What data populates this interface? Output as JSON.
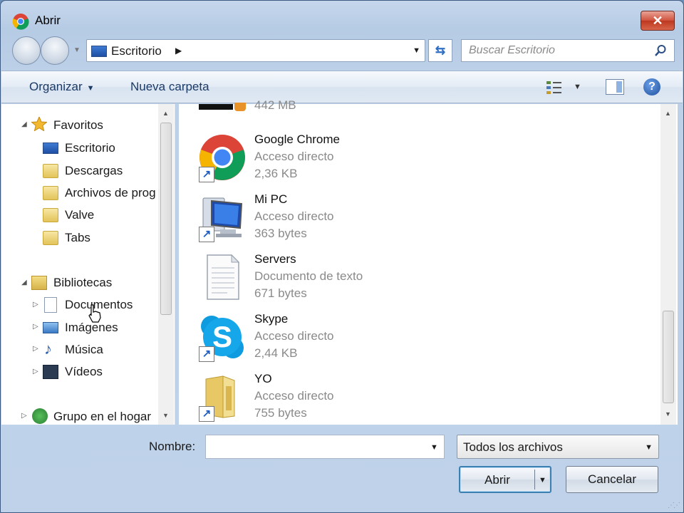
{
  "window": {
    "title": "Abrir",
    "close_label": "✕"
  },
  "address_bar": {
    "location": "Escritorio",
    "search_placeholder": "Buscar Escritorio"
  },
  "toolbar": {
    "organize_label": "Organizar",
    "new_folder_label": "Nueva carpeta"
  },
  "nav_tree": {
    "favorites": {
      "label": "Favoritos",
      "items": [
        "Escritorio",
        "Descargas",
        "Archivos de prog",
        "Valve",
        "Tabs"
      ]
    },
    "libraries": {
      "label": "Bibliotecas",
      "items": [
        "Documentos",
        "Imágenes",
        "Música",
        "Vídeos"
      ]
    },
    "homegroup": "Grupo en el hogar"
  },
  "files": [
    {
      "size": "442 MB"
    },
    {
      "name": "Google Chrome",
      "type": "Acceso directo",
      "size": "2,36 KB",
      "icon": "chrome-icon"
    },
    {
      "name": "Mi PC",
      "type": "Acceso directo",
      "size": "363 bytes",
      "icon": "computer-icon"
    },
    {
      "name": "Servers",
      "type": "Documento de texto",
      "size": "671 bytes",
      "icon": "text-document-icon"
    },
    {
      "name": "Skype",
      "type": "Acceso directo",
      "size": "2,44 KB",
      "icon": "skype-icon"
    },
    {
      "name": "YO",
      "type": "Acceso directo",
      "size": "755 bytes",
      "icon": "folder-icon"
    }
  ],
  "bottom": {
    "name_label": "Nombre:",
    "name_value": "",
    "filter_value": "Todos los archivos",
    "open_label": "Abrir",
    "cancel_label": "Cancelar"
  },
  "colors": {
    "accent": "#3c7fb1",
    "close": "#c8412a",
    "title_bar": "#c6d7ec"
  }
}
